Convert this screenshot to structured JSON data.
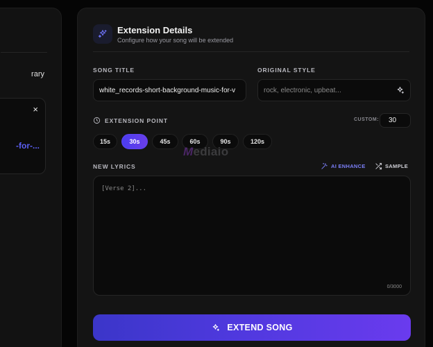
{
  "left_panel": {
    "library_label": "rary",
    "close_glyph": "×",
    "song_link": "-for-..."
  },
  "header": {
    "icon": "sparkles-icon",
    "title": "Extension Details",
    "subtitle": "Configure how your song will be extended"
  },
  "song_title": {
    "label": "SONG TITLE",
    "value": "white_records-short-background-music-for-v"
  },
  "original_style": {
    "label": "ORIGINAL STYLE",
    "placeholder": "rock, electronic, upbeat...",
    "icon": "sparkle-icon"
  },
  "extension_point": {
    "label": "EXTENSION POINT",
    "icon": "clock-icon",
    "custom_label": "CUSTOM:",
    "custom_value": "30",
    "options": [
      "15s",
      "30s",
      "45s",
      "60s",
      "90s",
      "120s"
    ],
    "selected": "30s"
  },
  "watermark": {
    "mark": "M",
    "text": "ediaio"
  },
  "lyrics": {
    "label": "NEW LYRICS",
    "ai_enhance": "AI ENHANCE",
    "sample": "SAMPLE",
    "placeholder": "[Verse 2]...",
    "counter": "0/3000"
  },
  "extend_button": {
    "label": "EXTEND SONG",
    "icon": "sparkle-icon"
  },
  "colors": {
    "accent": "#5b4af0",
    "accent_light": "#7b7ff7",
    "background": "#050505",
    "panel": "#141414"
  }
}
